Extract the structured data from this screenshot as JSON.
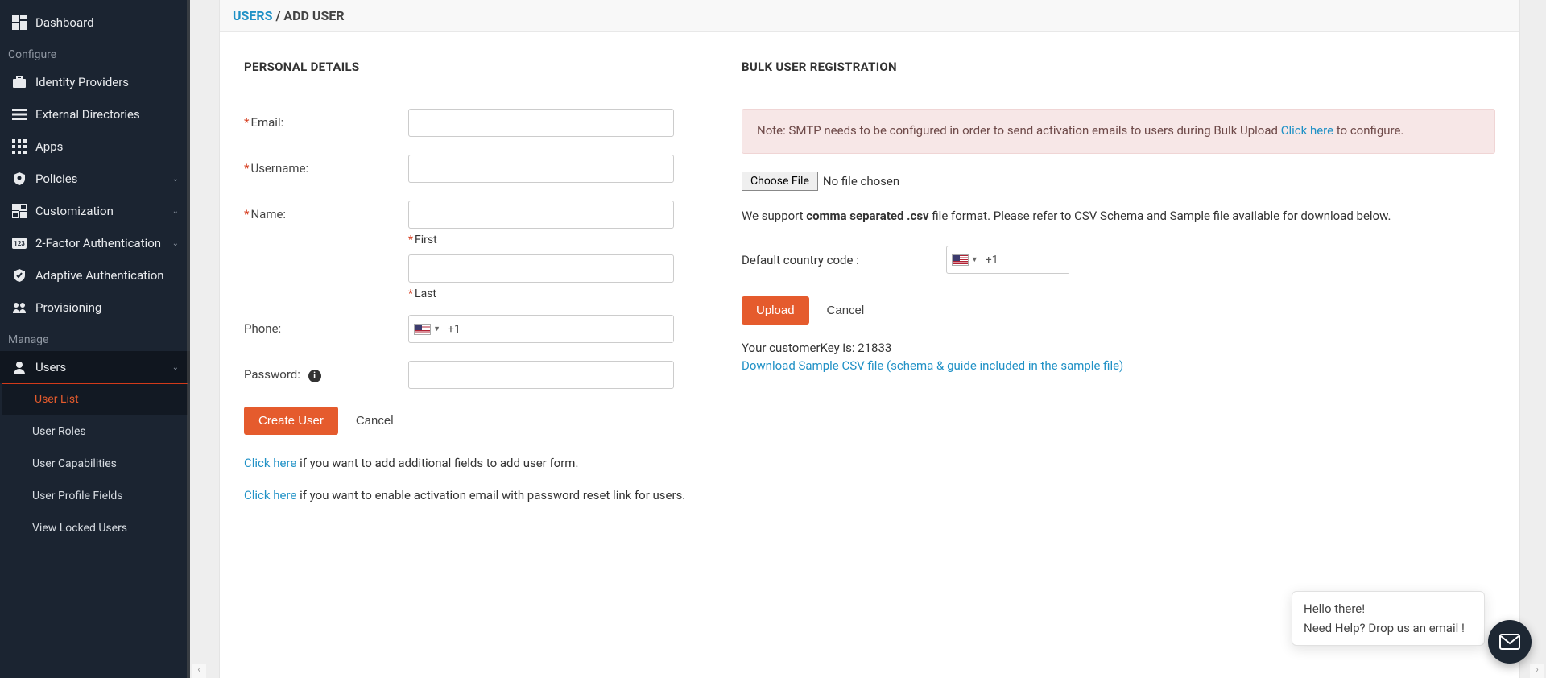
{
  "sidebar": {
    "items": [
      {
        "label": "Dashboard"
      }
    ],
    "configure_label": "Configure",
    "configure_items": [
      {
        "label": "Identity Providers",
        "chevron": false
      },
      {
        "label": "External Directories",
        "chevron": false
      },
      {
        "label": "Apps",
        "chevron": false
      },
      {
        "label": "Policies",
        "chevron": true
      },
      {
        "label": "Customization",
        "chevron": true
      },
      {
        "label": "2-Factor Authentication",
        "chevron": true
      },
      {
        "label": "Adaptive Authentication",
        "chevron": false
      },
      {
        "label": "Provisioning",
        "chevron": false
      }
    ],
    "manage_label": "Manage",
    "users_label": "Users",
    "users_subitems": [
      {
        "label": "User List",
        "active": true
      },
      {
        "label": "User Roles"
      },
      {
        "label": "User Capabilities"
      },
      {
        "label": "User Profile Fields"
      },
      {
        "label": "View Locked Users"
      }
    ]
  },
  "breadcrumb": {
    "root": "USERS",
    "sep": " / ",
    "current": "ADD USER"
  },
  "left": {
    "section_title": "PERSONAL DETAILS",
    "labels": {
      "email": "Email:",
      "username": "Username:",
      "name": "Name:",
      "first": "First",
      "last": "Last",
      "phone": "Phone:",
      "password": "Password:"
    },
    "phone_prefix": "+1",
    "buttons": {
      "create": "Create User",
      "cancel": "Cancel"
    },
    "hint1_link": "Click here",
    "hint1_rest": " if you want to add additional fields to add user form.",
    "hint2_link": "Click here",
    "hint2_rest": " if you want to enable activation email with password reset link for users."
  },
  "right": {
    "section_title": "BULK USER REGISTRATION",
    "alert_pre": "Note: SMTP needs to be configured in order to send activation emails to users during Bulk Upload ",
    "alert_link": "Click here",
    "alert_post": " to configure.",
    "file_button": "Choose File",
    "file_status": "No file chosen",
    "support_pre": "We support ",
    "support_bold": "comma separated .csv",
    "support_post": " file format. Please refer to CSV Schema and Sample file available for download below.",
    "cc_label": "Default country code :",
    "cc_prefix": "+1",
    "upload_btn": "Upload",
    "cancel_btn": "Cancel",
    "key_label": "Your customerKey is: ",
    "key_value": "21833",
    "dl_link": "Download Sample CSV file (schema & guide included in the sample file)"
  },
  "chat": {
    "line1": "Hello there!",
    "line2": "Need Help? Drop us an email !"
  }
}
